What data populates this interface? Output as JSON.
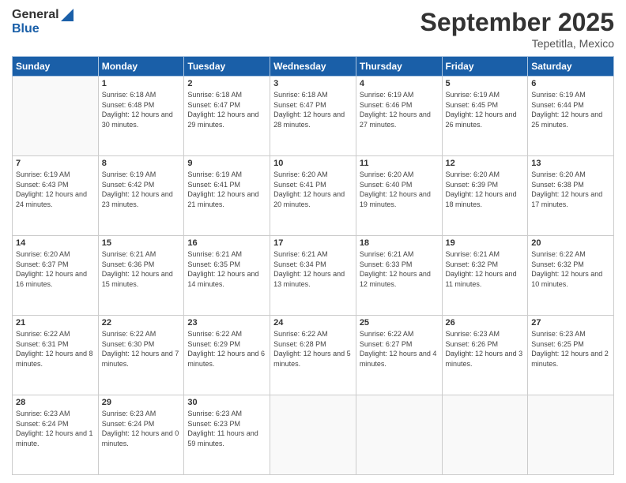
{
  "header": {
    "logo_line1": "General",
    "logo_line2": "Blue",
    "month_title": "September 2025",
    "location": "Tepetitla, Mexico"
  },
  "weekdays": [
    "Sunday",
    "Monday",
    "Tuesday",
    "Wednesday",
    "Thursday",
    "Friday",
    "Saturday"
  ],
  "weeks": [
    [
      {
        "day": "",
        "sunrise": "",
        "sunset": "",
        "daylight": ""
      },
      {
        "day": "1",
        "sunrise": "6:18 AM",
        "sunset": "6:48 PM",
        "daylight": "12 hours and 30 minutes."
      },
      {
        "day": "2",
        "sunrise": "6:18 AM",
        "sunset": "6:47 PM",
        "daylight": "12 hours and 29 minutes."
      },
      {
        "day": "3",
        "sunrise": "6:18 AM",
        "sunset": "6:47 PM",
        "daylight": "12 hours and 28 minutes."
      },
      {
        "day": "4",
        "sunrise": "6:19 AM",
        "sunset": "6:46 PM",
        "daylight": "12 hours and 27 minutes."
      },
      {
        "day": "5",
        "sunrise": "6:19 AM",
        "sunset": "6:45 PM",
        "daylight": "12 hours and 26 minutes."
      },
      {
        "day": "6",
        "sunrise": "6:19 AM",
        "sunset": "6:44 PM",
        "daylight": "12 hours and 25 minutes."
      }
    ],
    [
      {
        "day": "7",
        "sunrise": "6:19 AM",
        "sunset": "6:43 PM",
        "daylight": "12 hours and 24 minutes."
      },
      {
        "day": "8",
        "sunrise": "6:19 AM",
        "sunset": "6:42 PM",
        "daylight": "12 hours and 23 minutes."
      },
      {
        "day": "9",
        "sunrise": "6:19 AM",
        "sunset": "6:41 PM",
        "daylight": "12 hours and 21 minutes."
      },
      {
        "day": "10",
        "sunrise": "6:20 AM",
        "sunset": "6:41 PM",
        "daylight": "12 hours and 20 minutes."
      },
      {
        "day": "11",
        "sunrise": "6:20 AM",
        "sunset": "6:40 PM",
        "daylight": "12 hours and 19 minutes."
      },
      {
        "day": "12",
        "sunrise": "6:20 AM",
        "sunset": "6:39 PM",
        "daylight": "12 hours and 18 minutes."
      },
      {
        "day": "13",
        "sunrise": "6:20 AM",
        "sunset": "6:38 PM",
        "daylight": "12 hours and 17 minutes."
      }
    ],
    [
      {
        "day": "14",
        "sunrise": "6:20 AM",
        "sunset": "6:37 PM",
        "daylight": "12 hours and 16 minutes."
      },
      {
        "day": "15",
        "sunrise": "6:21 AM",
        "sunset": "6:36 PM",
        "daylight": "12 hours and 15 minutes."
      },
      {
        "day": "16",
        "sunrise": "6:21 AM",
        "sunset": "6:35 PM",
        "daylight": "12 hours and 14 minutes."
      },
      {
        "day": "17",
        "sunrise": "6:21 AM",
        "sunset": "6:34 PM",
        "daylight": "12 hours and 13 minutes."
      },
      {
        "day": "18",
        "sunrise": "6:21 AM",
        "sunset": "6:33 PM",
        "daylight": "12 hours and 12 minutes."
      },
      {
        "day": "19",
        "sunrise": "6:21 AM",
        "sunset": "6:32 PM",
        "daylight": "12 hours and 11 minutes."
      },
      {
        "day": "20",
        "sunrise": "6:22 AM",
        "sunset": "6:32 PM",
        "daylight": "12 hours and 10 minutes."
      }
    ],
    [
      {
        "day": "21",
        "sunrise": "6:22 AM",
        "sunset": "6:31 PM",
        "daylight": "12 hours and 8 minutes."
      },
      {
        "day": "22",
        "sunrise": "6:22 AM",
        "sunset": "6:30 PM",
        "daylight": "12 hours and 7 minutes."
      },
      {
        "day": "23",
        "sunrise": "6:22 AM",
        "sunset": "6:29 PM",
        "daylight": "12 hours and 6 minutes."
      },
      {
        "day": "24",
        "sunrise": "6:22 AM",
        "sunset": "6:28 PM",
        "daylight": "12 hours and 5 minutes."
      },
      {
        "day": "25",
        "sunrise": "6:22 AM",
        "sunset": "6:27 PM",
        "daylight": "12 hours and 4 minutes."
      },
      {
        "day": "26",
        "sunrise": "6:23 AM",
        "sunset": "6:26 PM",
        "daylight": "12 hours and 3 minutes."
      },
      {
        "day": "27",
        "sunrise": "6:23 AM",
        "sunset": "6:25 PM",
        "daylight": "12 hours and 2 minutes."
      }
    ],
    [
      {
        "day": "28",
        "sunrise": "6:23 AM",
        "sunset": "6:24 PM",
        "daylight": "12 hours and 1 minute."
      },
      {
        "day": "29",
        "sunrise": "6:23 AM",
        "sunset": "6:24 PM",
        "daylight": "12 hours and 0 minutes."
      },
      {
        "day": "30",
        "sunrise": "6:23 AM",
        "sunset": "6:23 PM",
        "daylight": "11 hours and 59 minutes."
      },
      {
        "day": "",
        "sunrise": "",
        "sunset": "",
        "daylight": ""
      },
      {
        "day": "",
        "sunrise": "",
        "sunset": "",
        "daylight": ""
      },
      {
        "day": "",
        "sunrise": "",
        "sunset": "",
        "daylight": ""
      },
      {
        "day": "",
        "sunrise": "",
        "sunset": "",
        "daylight": ""
      }
    ]
  ],
  "labels": {
    "sunrise": "Sunrise:",
    "sunset": "Sunset:",
    "daylight": "Daylight:"
  }
}
